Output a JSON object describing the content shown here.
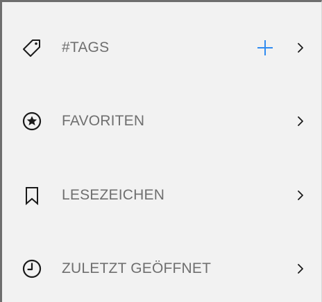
{
  "colors": {
    "background": "#f2f2f2",
    "label": "#6f6f6f",
    "icon": "#1a1a1a",
    "accent": "#2f8bf1",
    "chevron": "#1a1a1a"
  },
  "menu": {
    "items": [
      {
        "label": "#TAGS",
        "icon": "tag-icon",
        "has_add": true
      },
      {
        "label": "FAVORITEN",
        "icon": "star-circle-icon"
      },
      {
        "label": "LESEZEICHEN",
        "icon": "bookmark-icon"
      },
      {
        "label": "ZULETZT GEÖFFNET",
        "icon": "clock-icon"
      }
    ]
  }
}
